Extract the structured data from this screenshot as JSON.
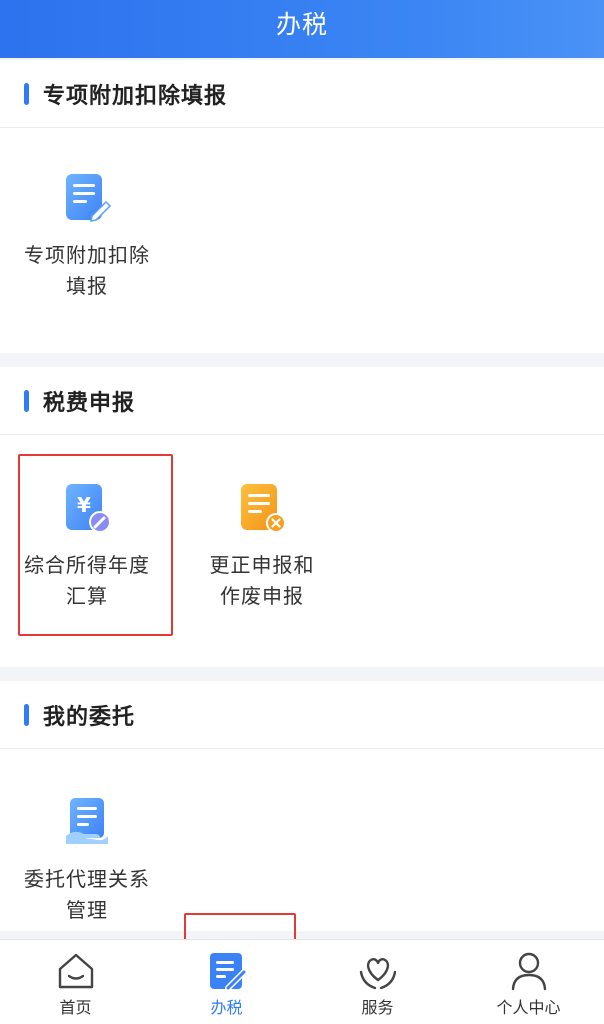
{
  "header": {
    "title": "办税"
  },
  "sections": [
    {
      "title": "专项附加扣除填报",
      "items": [
        {
          "label_line1": "专项附加扣除",
          "label_line2": "填报",
          "icon": "edit-document-icon"
        }
      ]
    },
    {
      "title": "税费申报",
      "items": [
        {
          "label_line1": "综合所得年度",
          "label_line2": "汇算",
          "icon": "yuan-document-icon"
        },
        {
          "label_line1": "更正申报和",
          "label_line2": "作废申报",
          "icon": "cancel-document-icon"
        }
      ]
    },
    {
      "title": "我的委托",
      "items": [
        {
          "label_line1": "委托代理关系",
          "label_line2": "管理",
          "icon": "hand-document-icon"
        }
      ]
    }
  ],
  "tabbar": {
    "items": [
      {
        "label": "首页",
        "icon": "home-icon"
      },
      {
        "label": "办税",
        "icon": "tax-edit-icon",
        "active": true
      },
      {
        "label": "服务",
        "icon": "heart-hands-icon"
      },
      {
        "label": "个人中心",
        "icon": "person-icon"
      }
    ]
  },
  "colors": {
    "primary": "#2f7cf6",
    "header": "#3580f2",
    "orange": "#f5a020",
    "highlight": "#e53935"
  }
}
